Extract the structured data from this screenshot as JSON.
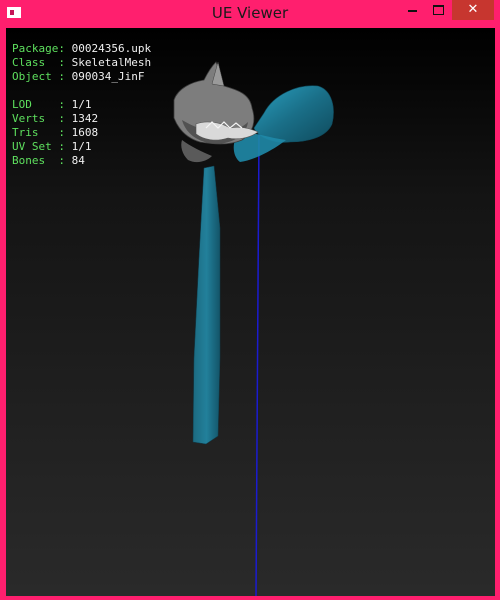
{
  "window": {
    "title": "UE Viewer",
    "icon": "app-window-icon",
    "controls": {
      "minimize": "minimize-icon",
      "maximize": "maximize-icon",
      "close": "✕"
    }
  },
  "info": {
    "package": {
      "key": "Package: ",
      "value": "00024356.upk"
    },
    "class": {
      "key": "Class  : ",
      "value": "SkeletalMesh"
    },
    "object": {
      "key": "Object : ",
      "value": "090034_JinF"
    },
    "lod": {
      "key": "LOD    : ",
      "value": "1/1"
    },
    "verts": {
      "key": "Verts  : ",
      "value": "1342"
    },
    "tris": {
      "key": "Tris   : ",
      "value": "1608"
    },
    "uvset": {
      "key": "UV Set : ",
      "value": "1/1"
    },
    "bones": {
      "key": "Bones  : ",
      "value": "84"
    }
  },
  "colors": {
    "title_bar": "#ff1f6e",
    "label": "#5ee05e",
    "value": "#f0f0f0",
    "mesh_cloth": "#1e7f9a",
    "mesh_gray": "#8a8a8a",
    "axis": "#1b1bd0"
  }
}
